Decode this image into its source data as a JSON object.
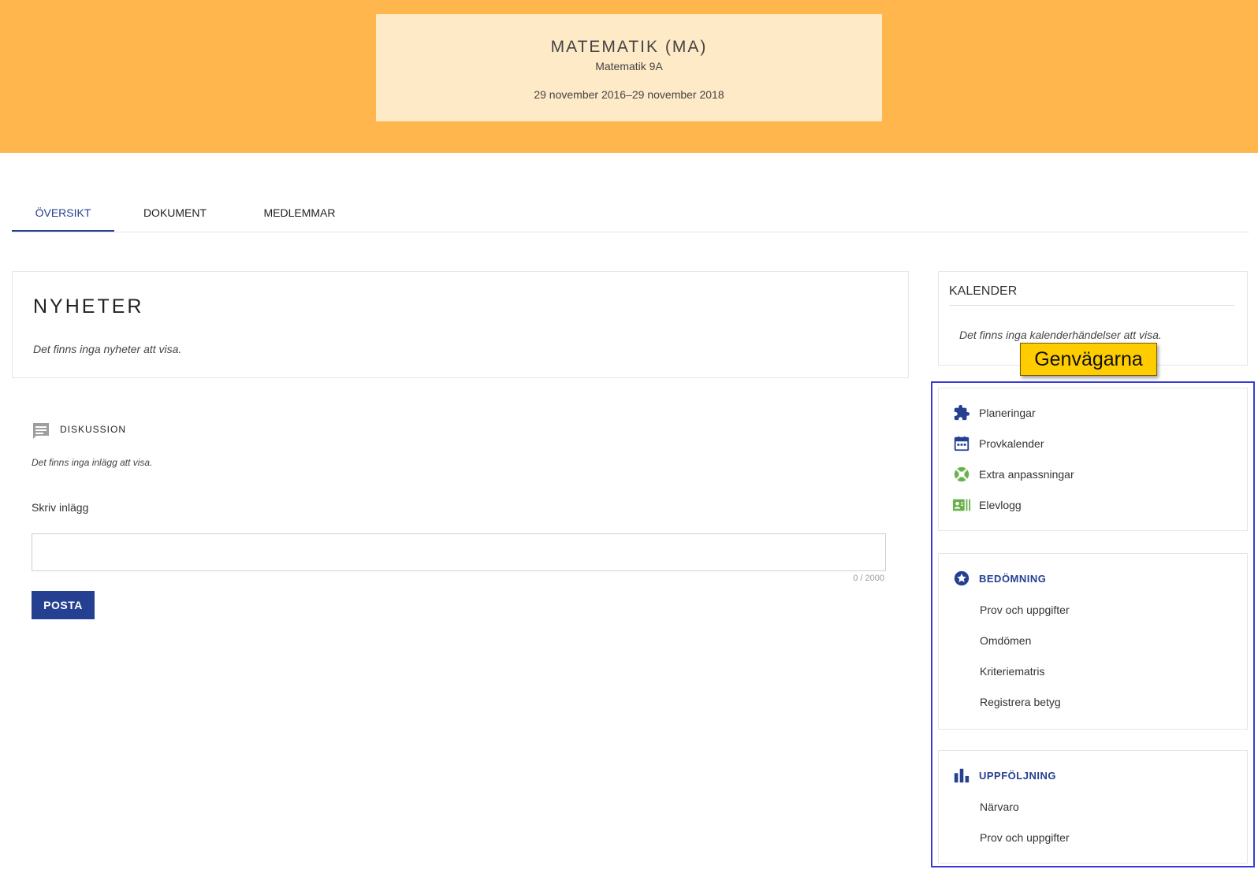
{
  "header": {
    "title": "MATEMATIK (MA)",
    "subtitle": "Matematik 9A",
    "dates": "29 november 2016–29 november 2018"
  },
  "tabs": [
    {
      "label": "ÖVERSIKT",
      "active": true
    },
    {
      "label": "DOKUMENT",
      "active": false
    },
    {
      "label": "MEDLEMMAR",
      "active": false
    }
  ],
  "news": {
    "title": "NYHETER",
    "empty": "Det finns inga nyheter att visa."
  },
  "discussion": {
    "label": "DISKUSSION",
    "empty": "Det finns inga inlägg att visa.",
    "write_label": "Skriv inlägg",
    "input_value": "",
    "counter": "0 / 2000",
    "post_button": "POSTA"
  },
  "calendar": {
    "title": "KALENDER",
    "empty": "Det finns inga kalenderhändelser att visa."
  },
  "tooltip": "Genvägarna",
  "shortcuts": {
    "tools": [
      {
        "label": "Planeringar",
        "icon": "puzzle-icon",
        "color": "#253f91"
      },
      {
        "label": "Provkalender",
        "icon": "calendar-icon",
        "color": "#253f91"
      },
      {
        "label": "Extra anpassningar",
        "icon": "lifebuoy-icon",
        "color": "#6ab04c"
      },
      {
        "label": "Elevlogg",
        "icon": "contact-card-icon",
        "color": "#6ab04c"
      }
    ],
    "assessment": {
      "title": "BEDÖMNING",
      "icon": "star-badge-icon",
      "items": [
        "Prov och uppgifter",
        "Omdömen",
        "Kriteriematris",
        "Registrera betyg"
      ]
    },
    "followup": {
      "title": "UPPFÖLJNING",
      "icon": "bar-chart-icon",
      "items": [
        "Närvaro",
        "Prov och uppgifter"
      ]
    }
  },
  "colors": {
    "header_band": "#ffb74d",
    "header_card": "#ffeac8",
    "accent": "#253f91",
    "green": "#6ab04c",
    "tooltip": "#ffcc00",
    "highlight": "#3a3ad6"
  }
}
